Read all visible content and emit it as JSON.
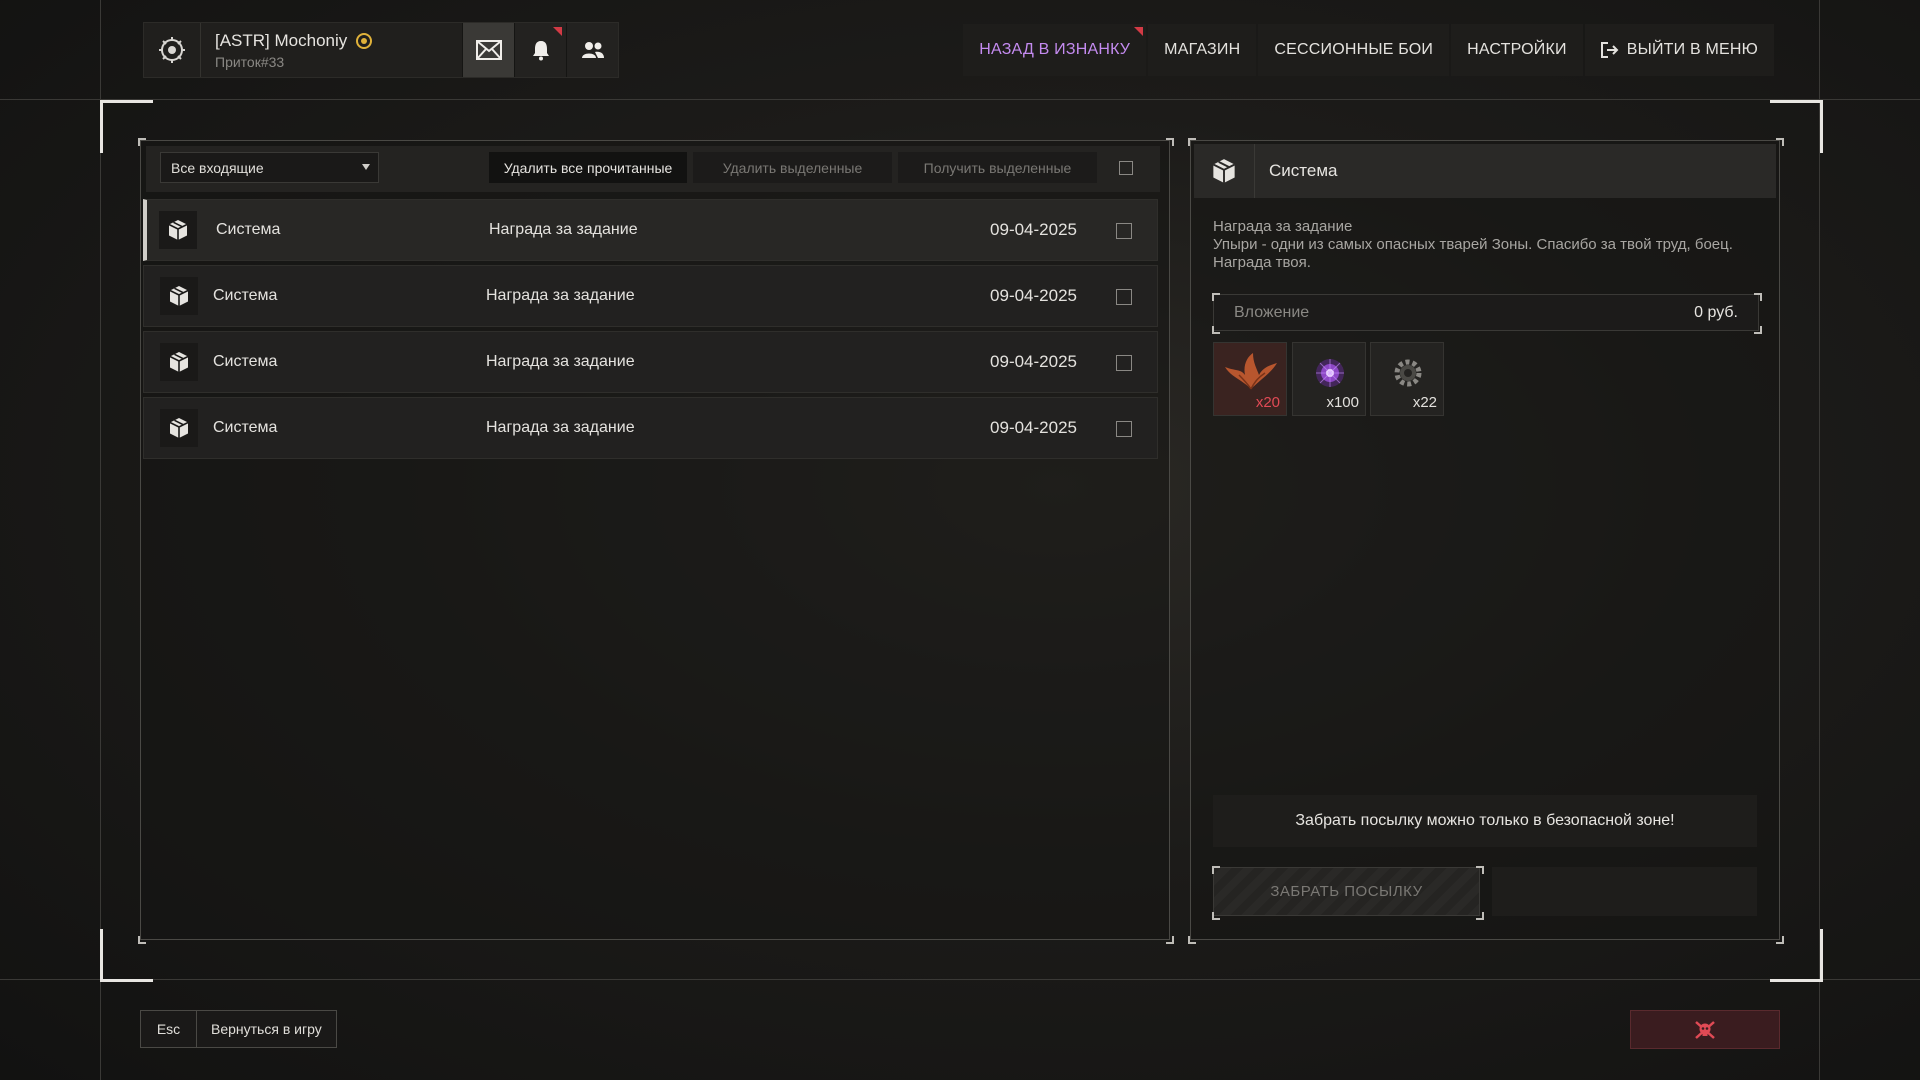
{
  "user": {
    "name": "[ASTR] Mochoniy",
    "subtitle": "Приток#33"
  },
  "top_icons": [
    "mail-icon",
    "bell-icon",
    "friends-icon"
  ],
  "nav": {
    "back": "НАЗАД В ИЗНАНКУ",
    "shop": "МАГАЗИН",
    "session": "СЕССИОННЫЕ БОИ",
    "settings": "НАСТРОЙКИ",
    "exit": "ВЫЙТИ В МЕНЮ"
  },
  "toolbar": {
    "filter": "Все входящие",
    "delete_read": "Удалить все прочитанные",
    "delete_selected": "Удалить выделенные",
    "get_selected": "Получить выделенные"
  },
  "mails": [
    {
      "from": "Система",
      "subject": "Награда за задание",
      "date": "09-04-2025"
    },
    {
      "from": "Система",
      "subject": "Награда за задание",
      "date": "09-04-2025"
    },
    {
      "from": "Система",
      "subject": "Награда за задание",
      "date": "09-04-2025"
    },
    {
      "from": "Система",
      "subject": "Награда за задание",
      "date": "09-04-2025"
    }
  ],
  "detail": {
    "from": "Система",
    "title": "Награда за задание",
    "body": "Упыри - одни из самых опасных тварей Зоны. Спасибо за твой труд, боец. Награда твоя.",
    "attachment_label": "Вложение",
    "attachment_value": "0 руб.",
    "items": [
      {
        "icon": "wings-icon",
        "qty": "x20"
      },
      {
        "icon": "purple-orb-icon",
        "qty": "x100"
      },
      {
        "icon": "gear-icon",
        "qty": "x22"
      }
    ],
    "notice": "Забрать посылку можно только в безопасной зоне!",
    "claim": "ЗАБРАТЬ ПОСЫЛКУ"
  },
  "footer": {
    "esc_key": "Esc",
    "esc_label": "Вернуться в игру"
  },
  "colors": {
    "accent_purple": "#c48bf0",
    "alert_red": "#d23a45",
    "qty_red": "#e04a55"
  }
}
